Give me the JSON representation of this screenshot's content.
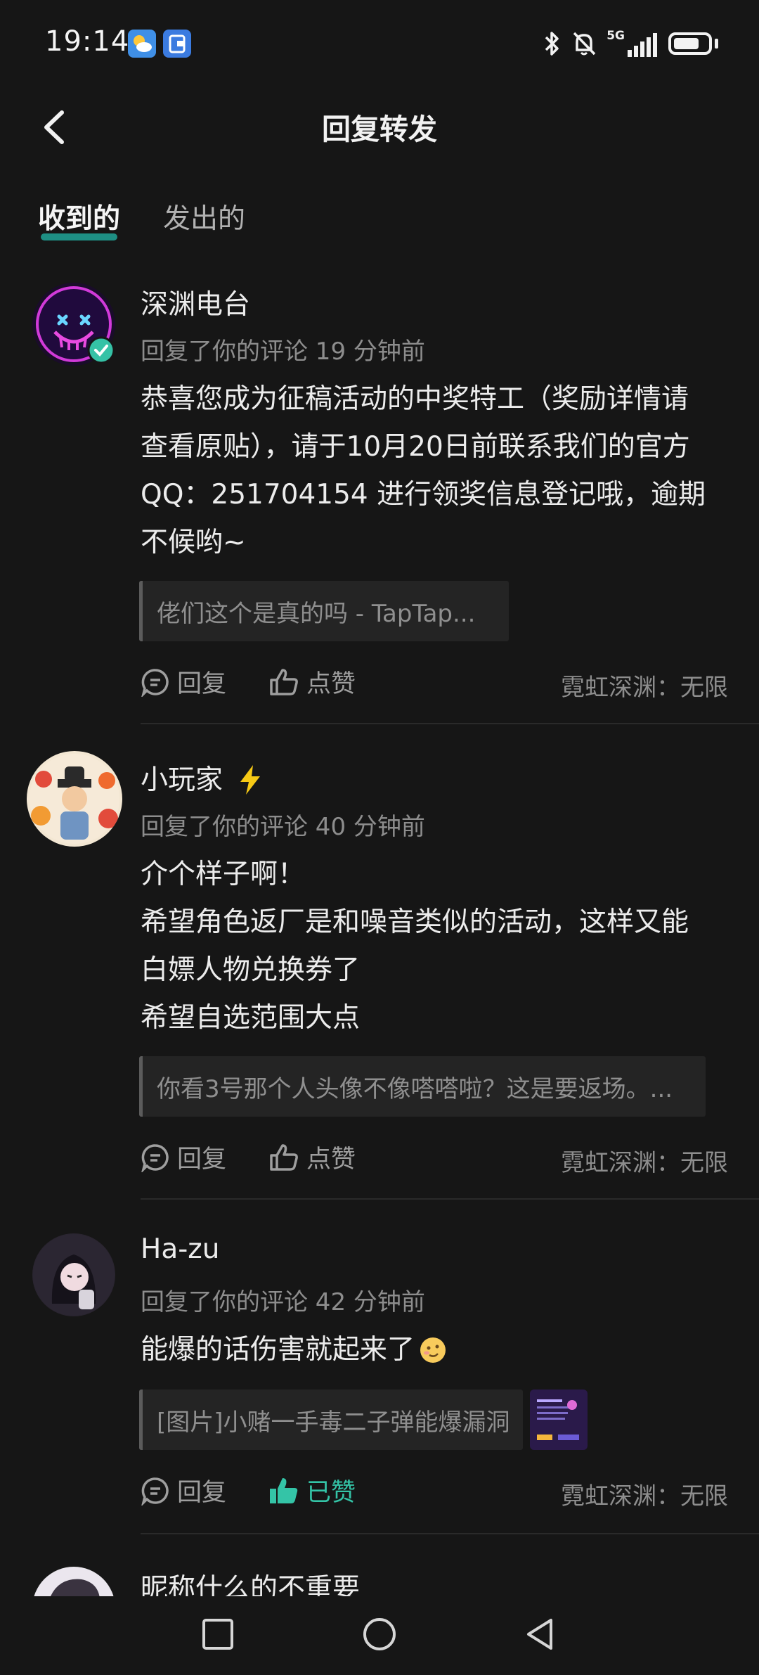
{
  "status_bar": {
    "time": "19:14",
    "network": "5G",
    "icons": [
      "weather-app-icon",
      "wallet-app-icon",
      "bluetooth-icon",
      "mute-bell-icon",
      "signal-icon",
      "battery-icon"
    ],
    "battery_level": 0.75
  },
  "header": {
    "title": "回复转发",
    "back_icon": "chevron-left-icon"
  },
  "tabs": [
    {
      "label": "收到的",
      "active": true
    },
    {
      "label": "发出的",
      "active": false
    }
  ],
  "notifications": [
    {
      "name": "深渊电台",
      "meta": "回复了你的评论 19 分钟前",
      "content_lines": [
        "恭喜您成为征稿活动的中奖特工（奖励详情请",
        "查看原贴），请于10月20日前联系我们的官方",
        "QQ：251704154 进行领奖信息登记哦，逾期",
        "不候哟~"
      ],
      "quote": "佬们这个是真的吗 - TapTap...",
      "reply_label": "回复",
      "like_label": "点赞",
      "source": "霓虹深渊：无限"
    },
    {
      "name": "小玩家",
      "name_badge": "lightning-icon",
      "meta": "回复了你的评论 40 分钟前",
      "content_lines": [
        "介个样子啊！",
        "希望角色返厂是和噪音类似的活动，这样又能",
        "白嫖人物兑换券了",
        "希望自选范围大点"
      ],
      "quote": "你看3号那个人头像不像嗒嗒啦？这是要返场。...",
      "reply_label": "回复",
      "like_label": "点赞",
      "source": "霓虹深渊：无限"
    },
    {
      "name": "Ha-zu",
      "meta": "回复了你的评论 42 分钟前",
      "content_lines": [
        "能爆的话伤害就起来了"
      ],
      "content_emoji": "smirk-emoji-icon",
      "quote": "[图片]小赌一手毒二子弹能爆漏洞",
      "reply_label": "回复",
      "like_label": "已赞",
      "source": "霓虹深渊：无限"
    },
    {
      "name": "昵称什么的不重要"
    }
  ],
  "nav_bar": {
    "buttons": [
      "recents-square-icon",
      "home-circle-icon",
      "back-triangle-icon"
    ]
  },
  "colors": {
    "background": "#161616",
    "accent": "#34c4a7",
    "tab_underline": "#1e8f84",
    "quote_bg": "#242424"
  }
}
